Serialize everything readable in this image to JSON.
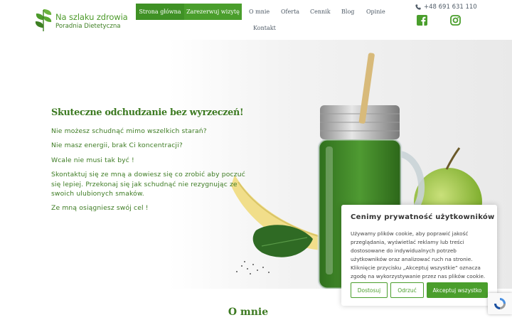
{
  "brand": {
    "name_line1": "Na szlaku zdrowia",
    "name_line2": "Poradnia Dietetyczna"
  },
  "nav": {
    "items": [
      {
        "label": "Strona główna"
      },
      {
        "label": "Zarezerwuj wizytę"
      },
      {
        "label": "O mnie"
      },
      {
        "label": "Oferta"
      },
      {
        "label": "Cennik"
      },
      {
        "label": "Blog"
      },
      {
        "label": "Opinie"
      },
      {
        "label": "Kontakt"
      }
    ]
  },
  "contact": {
    "phone": "+48 691 631 110",
    "phone_icon": "phone-icon",
    "social": [
      "facebook-icon",
      "instagram-icon"
    ]
  },
  "hero": {
    "title": "Skuteczne odchudzanie bez wyrzeczeń!",
    "paragraphs": [
      "Nie możesz schudnąć mimo wszelkich starań?",
      "Nie masz energii, brak Ci koncentracji?",
      "Wcale nie musi tak być !",
      "Skontaktuj się ze mną a dowiesz się co zrobić aby poczuć się lepiej. Przekonaj się jak schudnąć nie rezygnując ze swoich ulubionych smaków.",
      "Ze mną osiągniesz swój cel !"
    ]
  },
  "section": {
    "title": "O mnie"
  },
  "cookie": {
    "title": "Cenimy prywatność użytkowników",
    "text": "Używamy plików cookie, aby poprawić jakość przeglądania, wyświetlać reklamy lub treści dostosowane do indywidualnych potrzeb użytkowników oraz analizować ruch na stronie. Kliknięcie przycisku „Akceptuj wszystkie” oznacza zgodę na wykorzystywanie przez nas plików cookie.",
    "buttons": {
      "customize": "Dostosuj",
      "reject": "Odrzuć",
      "accept": "Akceptuj wszystko"
    }
  },
  "colors": {
    "brand_green": "#4a9e2c",
    "text_green": "#3d7a22",
    "nav_text": "#4e5a66"
  }
}
